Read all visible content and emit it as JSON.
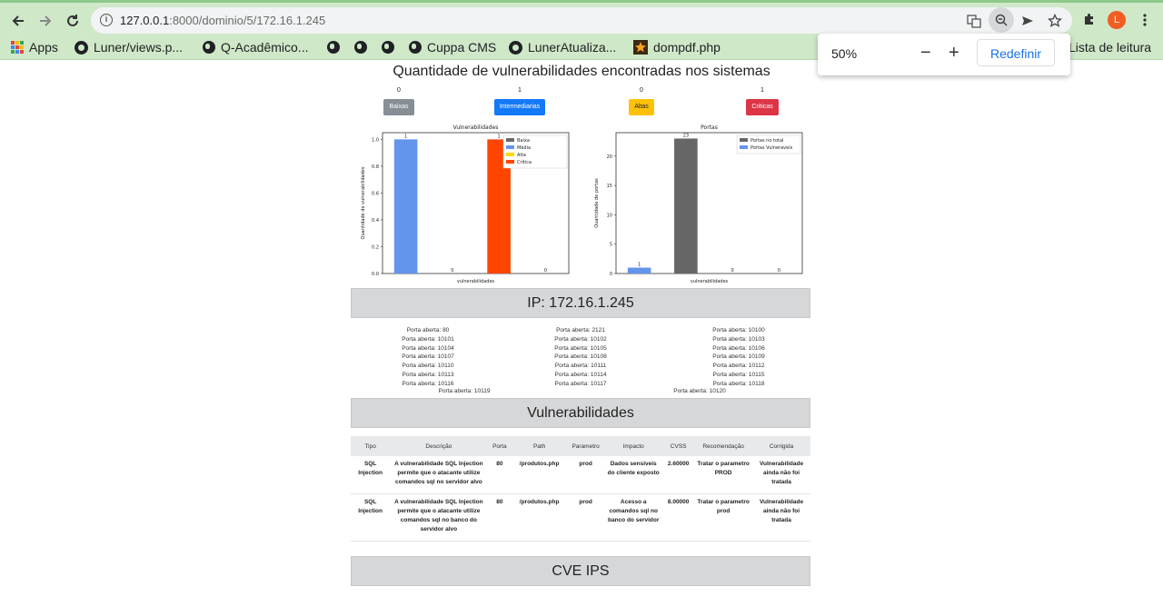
{
  "browser": {
    "url_host": "127.0.0.1",
    "url_path": ":8000/dominio/5/172.16.1.245",
    "bookmarks": [
      {
        "label": "Apps",
        "icon": "apps-grid-icon"
      },
      {
        "label": "Luner/views.p...",
        "icon": "github-icon"
      },
      {
        "label": "Q-Acadêmico...",
        "icon": "globe-icon"
      },
      {
        "label": "",
        "icon": "globe-icon"
      },
      {
        "label": "",
        "icon": "globe-icon"
      },
      {
        "label": "Cuppa CMS",
        "icon": "globe-icon"
      },
      {
        "label": "LunerAtualiza...",
        "icon": "github-icon"
      },
      {
        "label": "dompdf.php",
        "icon": "star-bookmark-icon"
      }
    ],
    "reading_list": "Lista de leitura",
    "avatar_letter": "L",
    "zoom_popup": {
      "value": "50%",
      "minus": "−",
      "plus": "+",
      "reset_label": "Redefinir"
    }
  },
  "page": {
    "title": "Quantidade de vulnerabilidades encontradas nos sistemas",
    "severity": [
      {
        "count": "0",
        "label": "Baixas",
        "color": "#868e96"
      },
      {
        "count": "1",
        "label": "Intermediarias",
        "color": "#1479f6"
      },
      {
        "count": "0",
        "label": "Altas",
        "color": "#ffc107"
      },
      {
        "count": "1",
        "label": "Criticas",
        "color": "#dc3545"
      }
    ],
    "ip_header": "IP: 172.16.1.245",
    "ports": {
      "prefix": "Porta aberta: ",
      "col1": [
        "80",
        "10101",
        "10104",
        "10107",
        "10110",
        "10113",
        "10116"
      ],
      "col2": [
        "2121",
        "10102",
        "10105",
        "10108",
        "10111",
        "10114",
        "10117"
      ],
      "col3": [
        "10100",
        "10103",
        "10106",
        "10109",
        "10112",
        "10115",
        "10118"
      ],
      "extra": [
        "Porta aberta: 10119",
        "Porta aberta: 10120"
      ]
    },
    "vuln_header": "Vulnerabilidades",
    "table": {
      "headers": [
        "Tipo",
        "Descrição",
        "Porta",
        "Path",
        "Parametro",
        "Impacto",
        "CVSS",
        "Recomendação",
        "Corrigida"
      ],
      "rows": [
        [
          "SQL Injection",
          "A vulnerabilidade SQL Injection permite que o atacante utilize comandos sql no servidor alvo",
          "80",
          "/produtos.php",
          "prod",
          "Dados sensiveis do cliente exposto",
          "2.60000",
          "Tratar o parametro PROD",
          "Vulnerabilidade ainda não foi tratada"
        ],
        [
          "SQL Injection",
          "A vulnerabilidade SQL Injection permite que o atacante utilize comandos sql no banco do servidor alvo",
          "80",
          "/produtos.php",
          "prod",
          "Acesso a comandos sql no banco do servidor",
          "8.00000",
          "Tratar o parametro prod",
          "Vulnerabilidade ainda não foi tratada"
        ]
      ]
    },
    "cve_header": "CVE IPS"
  },
  "chart_data": [
    {
      "type": "bar",
      "title": "Vulnerabilidades",
      "xlabel": "vulnerabilidades",
      "ylabel": "Quantidade de vulnerabilidades",
      "ylim": [
        0,
        1.05
      ],
      "yticks": [
        "0.0",
        "0.2",
        "0.4",
        "0.6",
        "0.8",
        "1.0"
      ],
      "legend_position": "top-right",
      "series": [
        {
          "name": "Baixa",
          "value": 0,
          "color": "#696969"
        },
        {
          "name": "Média",
          "value": 1,
          "color": "#6495ed"
        },
        {
          "name": "Alta",
          "value": 0,
          "color": "#ffd700"
        },
        {
          "name": "Crítica",
          "value": 1,
          "color": "#ff4500"
        }
      ],
      "visible_bars": [
        {
          "series": "Média",
          "value": 1,
          "label": "1"
        },
        {
          "series": "Baixa",
          "value": 0,
          "label": "0"
        },
        {
          "series": "Crítica",
          "value": 1,
          "label": "1"
        },
        {
          "series": "Alta",
          "value": 0,
          "label": "0"
        }
      ]
    },
    {
      "type": "bar",
      "title": "Portas",
      "xlabel": "vulnerabilidades",
      "ylabel": "Quantidade de portas",
      "ylim": [
        0,
        24
      ],
      "yticks": [
        "0",
        "5",
        "10",
        "15",
        "20"
      ],
      "legend_position": "top-right",
      "series": [
        {
          "name": "Portas no total",
          "value": 23,
          "color": "#666666"
        },
        {
          "name": "Portas Vulneraveis",
          "value": 1,
          "color": "#6495ed"
        }
      ],
      "visible_bars": [
        {
          "series": "Portas Vulneraveis",
          "value": 1,
          "label": "1"
        },
        {
          "series": "Portas no total",
          "value": 23,
          "label": "23"
        },
        {
          "series": "Portas no total",
          "value": 0,
          "label": "0"
        },
        {
          "series": "Portas Vulneraveis",
          "value": 0,
          "label": "0"
        }
      ]
    }
  ]
}
